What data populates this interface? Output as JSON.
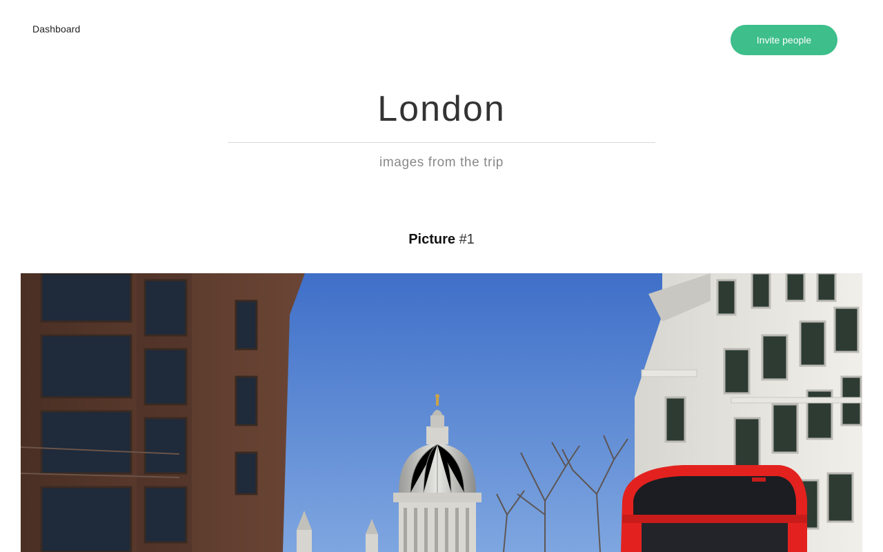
{
  "nav": {
    "dashboard_label": "Dashboard",
    "invite_label": "Invite people"
  },
  "album": {
    "title": "London",
    "subtitle": "images from the trip"
  },
  "picture": {
    "label": "Picture",
    "number": "#1"
  },
  "colors": {
    "accent": "#3dbe8a",
    "sky": "#4a7bd0",
    "bus_red": "#e3221f",
    "brick": "#5a3a2c",
    "stone": "#e9e7e2"
  },
  "icons": {
    "photo": "london-street-photo"
  }
}
